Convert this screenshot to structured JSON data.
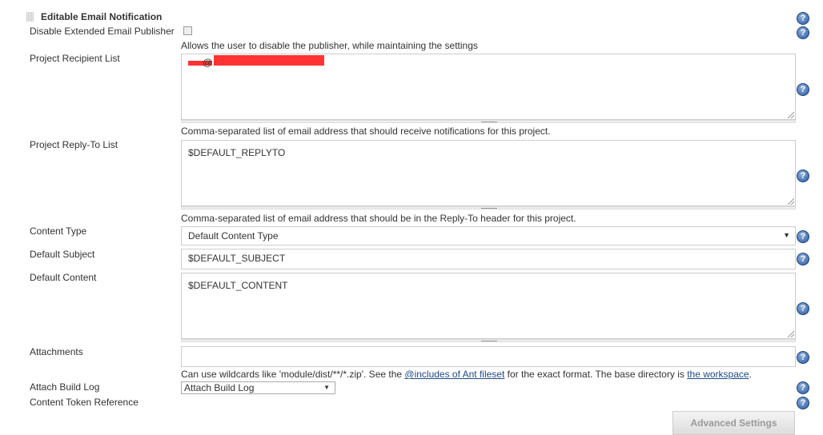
{
  "section": {
    "title": "Editable Email Notification"
  },
  "disable": {
    "label": "Disable Extended Email Publisher",
    "checked": false,
    "description": "Allows the user to disable the publisher, while maintaining the settings"
  },
  "recipients": {
    "label": "Project Recipient List",
    "value_visible": "@",
    "redacted": true,
    "redaction_color": "#ff3333",
    "description": "Comma-separated list of email address that should receive notifications for this project."
  },
  "replyto": {
    "label": "Project Reply-To List",
    "value": "$DEFAULT_REPLYTO",
    "description": "Comma-separated list of email address that should be in the Reply-To header for this project."
  },
  "content_type": {
    "label": "Content Type",
    "value": "Default Content Type"
  },
  "subject": {
    "label": "Default Subject",
    "value": "$DEFAULT_SUBJECT"
  },
  "content": {
    "label": "Default Content",
    "value": "$DEFAULT_CONTENT"
  },
  "attachments": {
    "label": "Attachments",
    "value": "",
    "desc_pre": "Can use wildcards like 'module/dist/**/*.zip'. See the ",
    "desc_link1": "@includes of Ant fileset",
    "desc_mid": " for the exact format. The base directory is ",
    "desc_link2": "the workspace",
    "desc_post": "."
  },
  "build_log": {
    "label": "Attach Build Log",
    "value": "Attach Build Log"
  },
  "token_ref": {
    "label": "Content Token Reference"
  },
  "advanced": {
    "label": "Advanced Settings"
  },
  "help_icon": "?"
}
